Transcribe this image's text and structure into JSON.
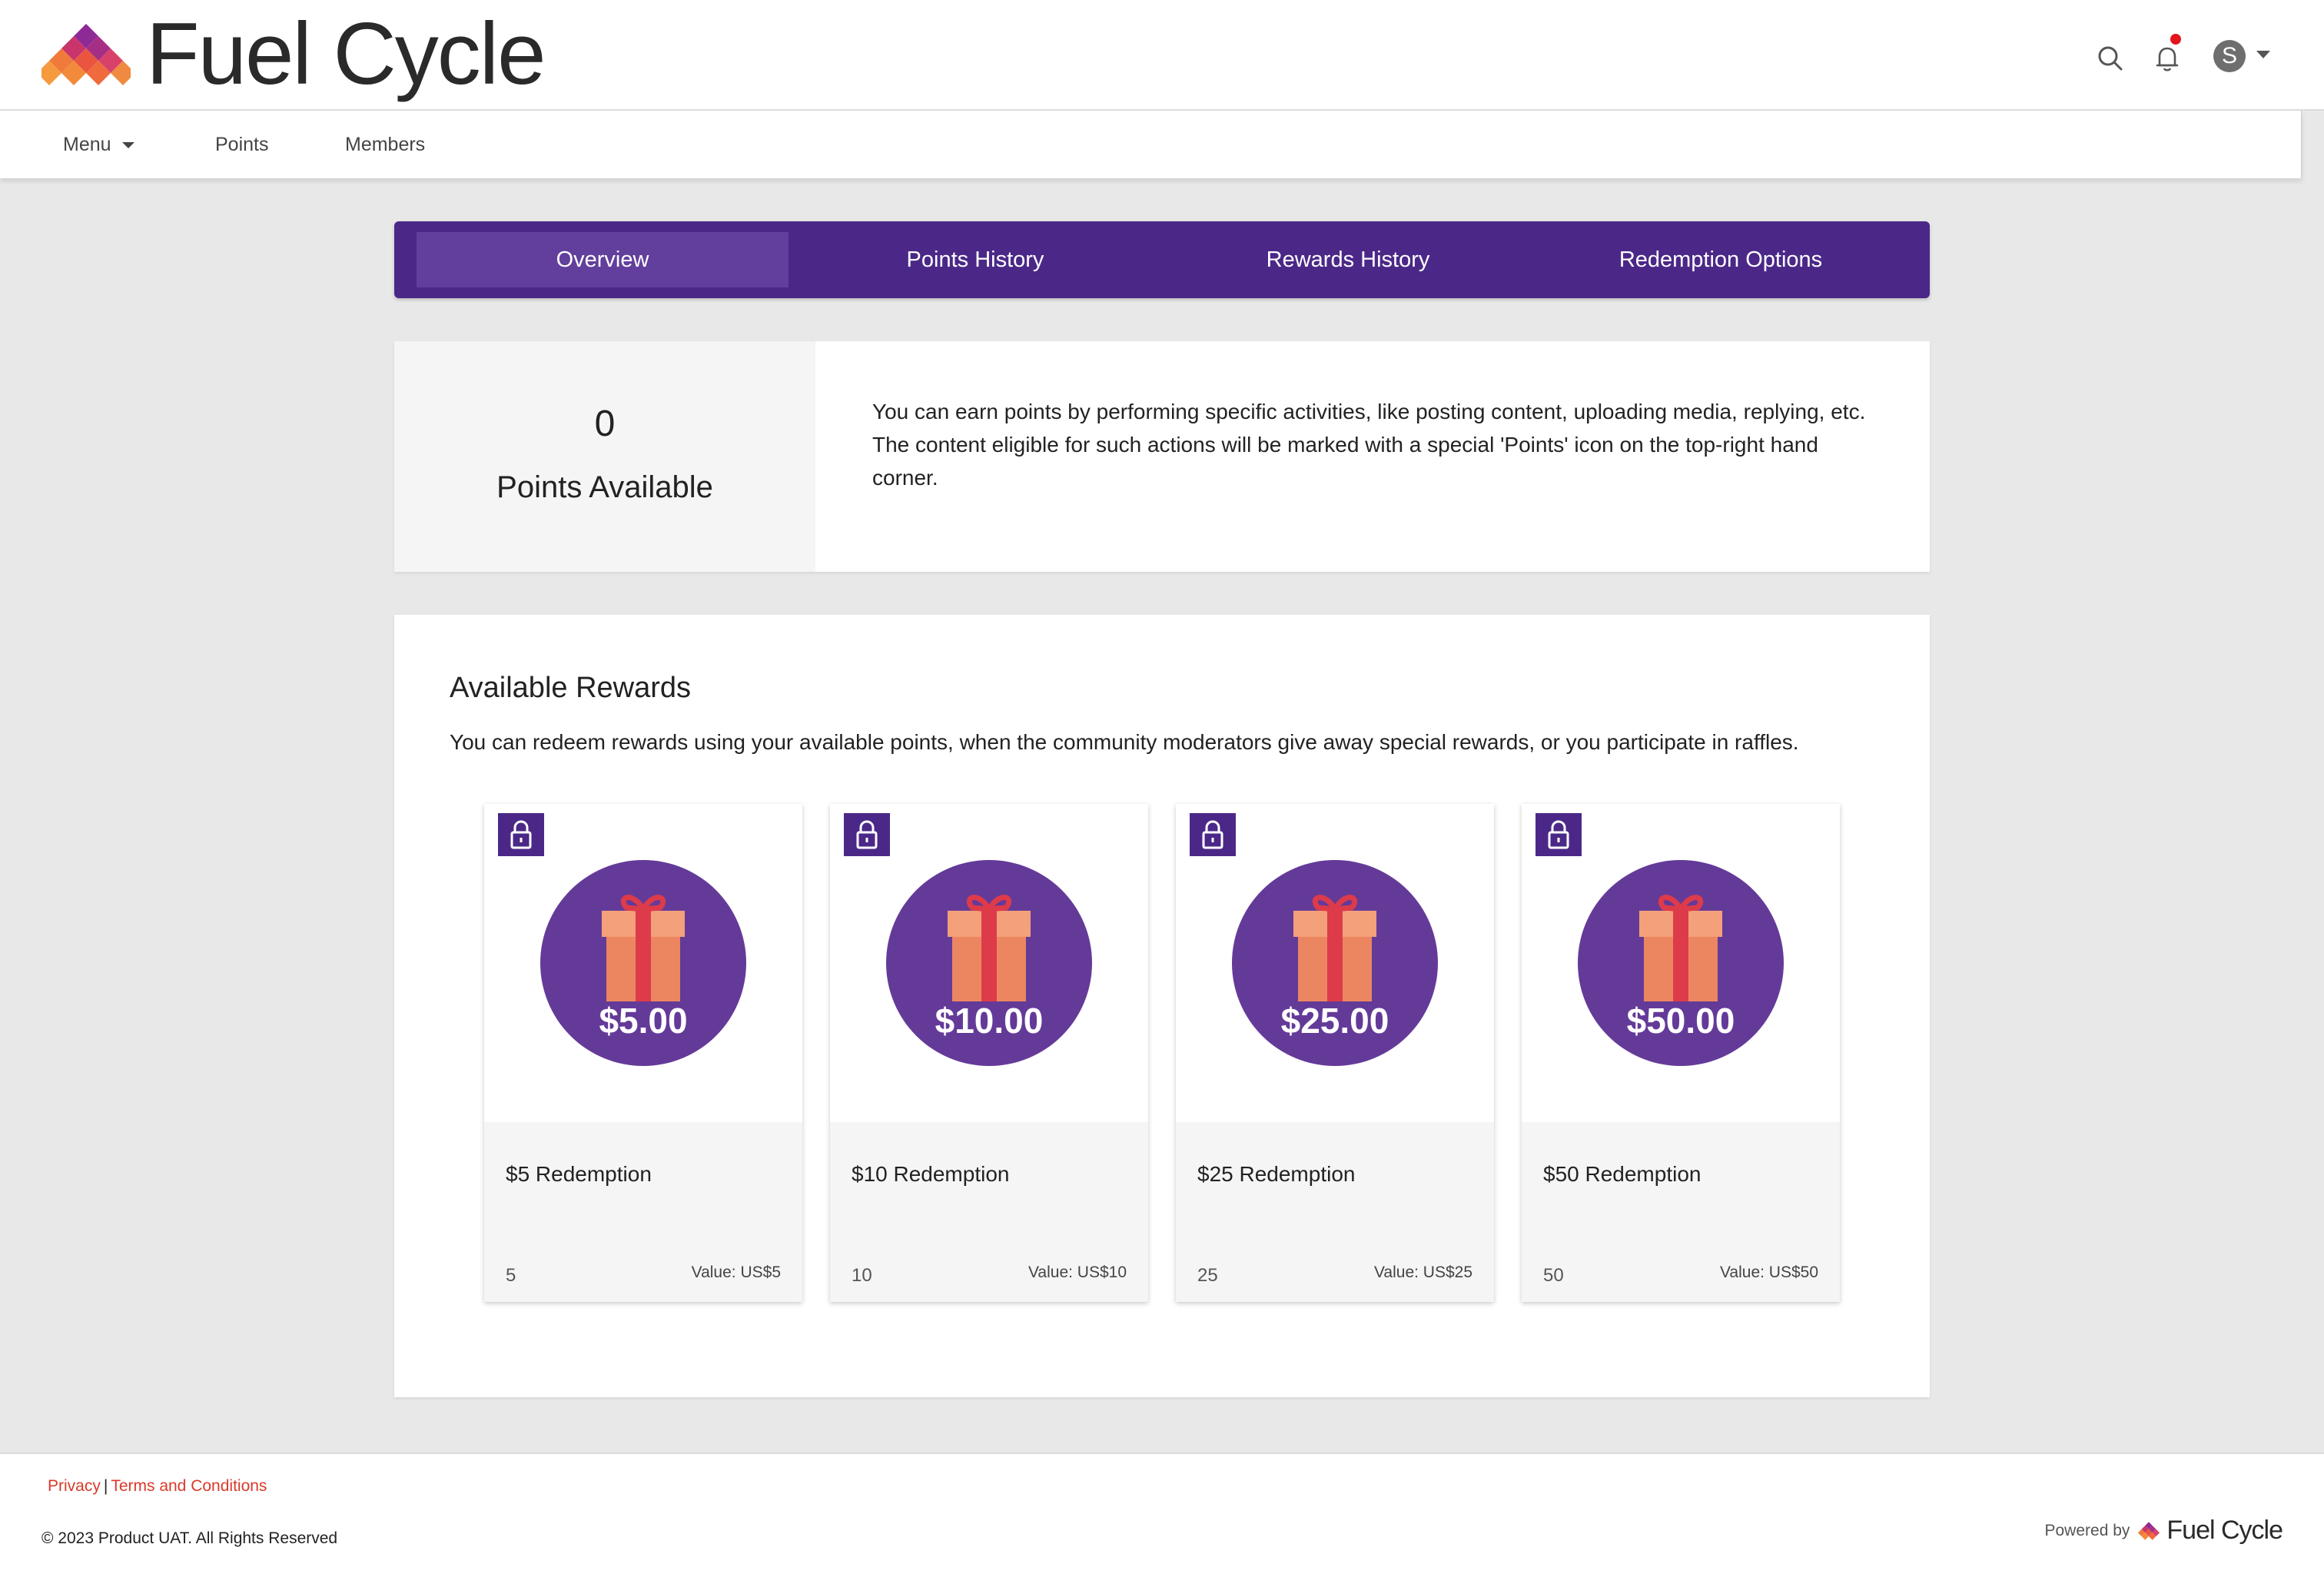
{
  "header": {
    "brand": "Fuel Cycle",
    "avatar_initial": "S"
  },
  "nav": {
    "menu": "Menu",
    "points": "Points",
    "members": "Members"
  },
  "tabs": [
    {
      "label": "Overview",
      "active": true
    },
    {
      "label": "Points History",
      "active": false
    },
    {
      "label": "Rewards History",
      "active": false
    },
    {
      "label": "Redemption Options",
      "active": false
    }
  ],
  "points": {
    "value": "0",
    "label": "Points Available",
    "description": "You can earn points by performing specific activities, like posting content, uploading media, replying, etc. The content eligible for such actions will be marked with a special 'Points' icon on the top-right hand corner."
  },
  "rewards": {
    "title": "Available Rewards",
    "description": "You can redeem rewards using your available points, when the community moderators give away special rewards, or you participate in raffles.",
    "items": [
      {
        "amount": "$5.00",
        "name": "$5 Redemption",
        "points": "5",
        "value": "Value: US$5"
      },
      {
        "amount": "$10.00",
        "name": "$10 Redemption",
        "points": "10",
        "value": "Value: US$10"
      },
      {
        "amount": "$25.00",
        "name": "$25 Redemption",
        "points": "25",
        "value": "Value: US$25"
      },
      {
        "amount": "$50.00",
        "name": "$50 Redemption",
        "points": "50",
        "value": "Value: US$50"
      }
    ]
  },
  "footer": {
    "privacy": "Privacy",
    "separator": "|",
    "terms": "Terms and Conditions",
    "copyright": "© 2023 Product UAT. All Rights Reserved",
    "powered_by": "Powered by",
    "powered_brand": "Fuel Cycle"
  },
  "colors": {
    "brand_purple": "#4b2888",
    "active_tab": "#623f9c",
    "gift_circle": "#643a99",
    "link_red": "#d93a2a",
    "notification_dot": "#e3161c"
  },
  "icons": {
    "search": "search-icon",
    "notifications": "bell-icon",
    "lock": "lock-icon",
    "gift": "gift-icon"
  }
}
